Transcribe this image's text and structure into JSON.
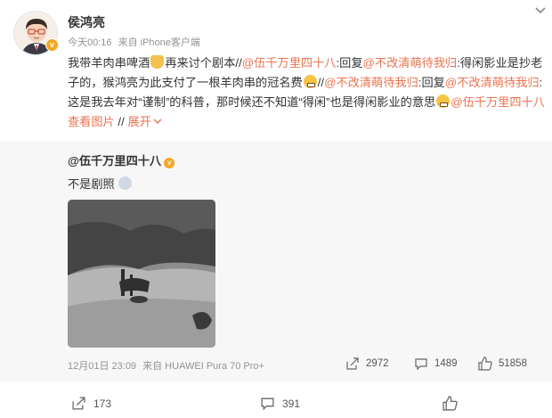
{
  "post": {
    "username": "侯鸿亮",
    "time": "今天00:16",
    "source": "来自 iPhone客户端",
    "text": {
      "p1": "我带羊肉串啤酒",
      "p2": "再来讨个剧本//",
      "at1": "@伍千万里四十八",
      "p3": ":回复",
      "at2": "@不改清萌待我归",
      "p4": ":得闲影业是抄老子的，猴鸿亮为此支付了一根羊肉串的冠名费",
      "p5": "//",
      "at3": "@不改清萌待我归",
      "p6": ":回复",
      "at4": "@不改清萌待我归",
      "p7": ":这是我去年对“谨制”的科普，那时候还不知道“得闲”也是得闲影业的意思",
      "at5": "@伍千万里四十八",
      "view_images": "查看图片",
      "sep": "//",
      "expand": "展开"
    },
    "emoji_names": [
      "beer-emoji",
      "thinking-emoji",
      "grin-emoji",
      "shock-emoji"
    ]
  },
  "repost": {
    "username": "@伍千万里四十八",
    "text": "不是剧照",
    "time": "12月01日 23:09",
    "source": "来自 HUAWEI Pura 70 Pro+",
    "reposts": "2972",
    "comments": "1489",
    "likes": "51858"
  },
  "footer": {
    "reposts": "173",
    "comments": "391"
  },
  "colors": {
    "accent": "#eb7350",
    "badge": "#f5a623",
    "meta": "#939393",
    "repost_bg": "#f7f7f7"
  }
}
